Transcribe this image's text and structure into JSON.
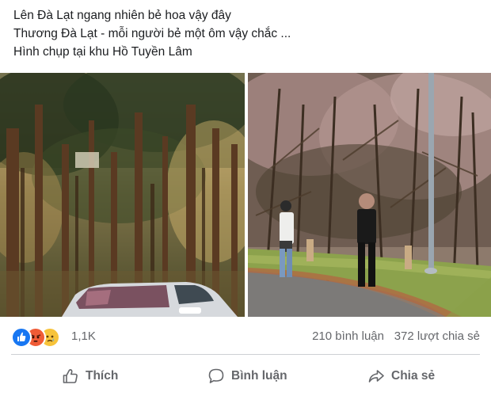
{
  "post": {
    "lines": [
      "Lên Đà Lạt ngang nhiên bẻ hoa vậy đây",
      "Thương Đà Lạt - mỗi người bẻ một ôm vậy chắc ...",
      "Hình chụp tại khu Hồ Tuyền Lâm"
    ]
  },
  "reactions": {
    "icons": [
      "like-icon",
      "angry-icon",
      "sad-icon"
    ],
    "count": "1,1K",
    "comments": "210 bình luận",
    "shares": "372 lượt chia sẻ"
  },
  "actions": {
    "like_label": "Thích",
    "comment_label": "Bình luận",
    "share_label": "Chia sẻ"
  },
  "colors": {
    "like_blue": "#1877f2",
    "angry_orange": "#f05b36",
    "sad_yellow": "#f7c33a",
    "secondary_text": "#65676b"
  }
}
